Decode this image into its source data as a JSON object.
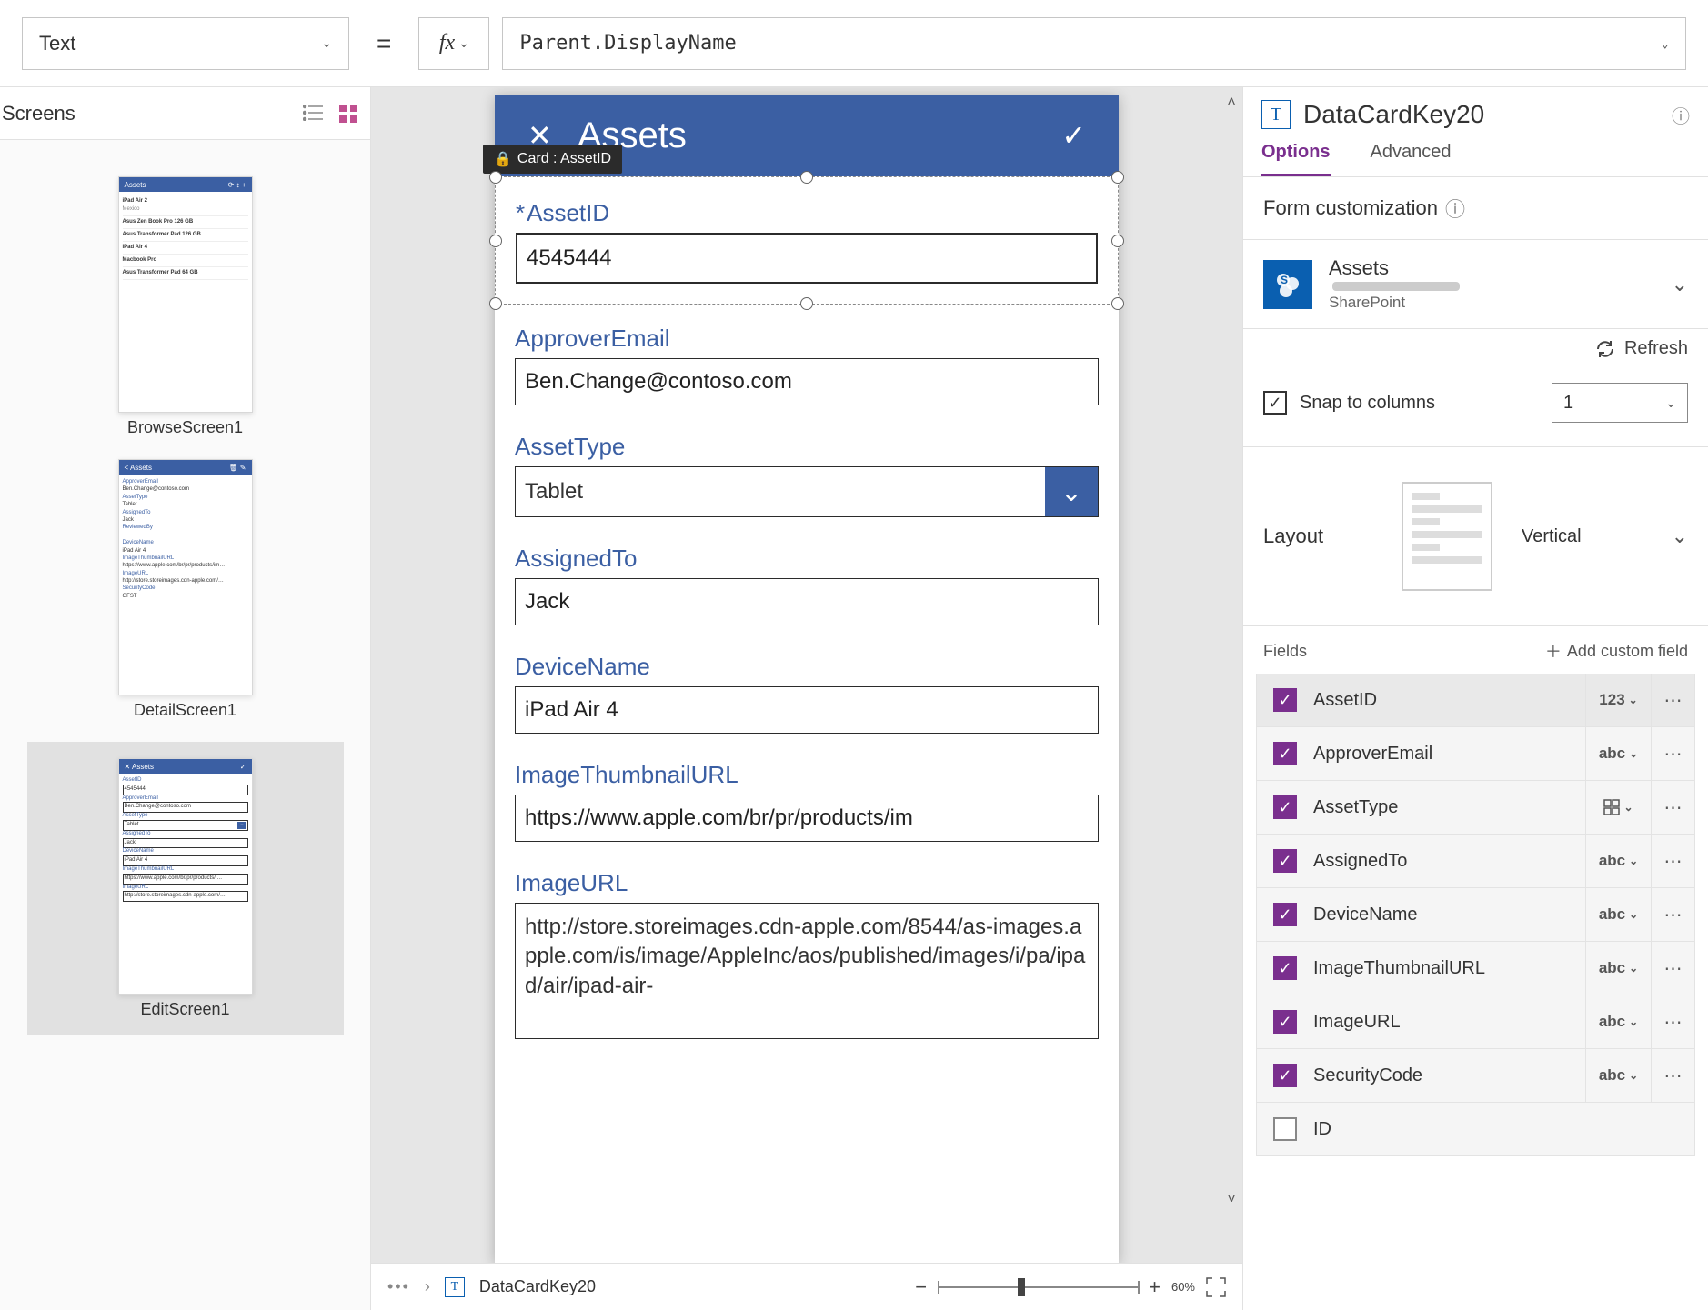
{
  "formulaBar": {
    "property": "Text",
    "formula": "Parent.DisplayName"
  },
  "leftPanel": {
    "title": "Screens",
    "screens": [
      {
        "name": "BrowseScreen1"
      },
      {
        "name": "DetailScreen1"
      },
      {
        "name": "EditScreen1"
      }
    ]
  },
  "canvas": {
    "appHeader": "Assets",
    "selectedCardTooltip": "Card : AssetID",
    "form": {
      "assetId": {
        "label": "AssetID",
        "value": "4545444",
        "required": true
      },
      "approverEmail": {
        "label": "ApproverEmail",
        "value": "Ben.Change@contoso.com"
      },
      "assetType": {
        "label": "AssetType",
        "value": "Tablet"
      },
      "assignedTo": {
        "label": "AssignedTo",
        "value": "Jack"
      },
      "deviceName": {
        "label": "DeviceName",
        "value": "iPad Air 4"
      },
      "imageThumbnailUrl": {
        "label": "ImageThumbnailURL",
        "value": "https://www.apple.com/br/pr/products/im"
      },
      "imageUrl": {
        "label": "ImageURL",
        "value": "http://store.storeimages.cdn-apple.com/8544/as-images.apple.com/is/image/AppleInc/aos/published/images/i/pa/ipad/air/ipad-air-"
      }
    }
  },
  "statusBar": {
    "breadcrumb": "DataCardKey20",
    "zoom": "60%"
  },
  "rightPanel": {
    "elementName": "DataCardKey20",
    "tabs": {
      "options": "Options",
      "advanced": "Advanced"
    },
    "formCustomization": "Form customization",
    "dataSource": {
      "name": "Assets",
      "provider": "SharePoint"
    },
    "refresh": "Refresh",
    "snapToColumns": {
      "label": "Snap to columns",
      "columns": "1"
    },
    "layout": {
      "label": "Layout",
      "value": "Vertical"
    },
    "fieldsHeader": "Fields",
    "addField": "Add custom field",
    "fields": [
      {
        "name": "AssetID",
        "type": "123",
        "checked": true,
        "selected": true
      },
      {
        "name": "ApproverEmail",
        "type": "abc",
        "checked": true
      },
      {
        "name": "AssetType",
        "type": "grid",
        "checked": true
      },
      {
        "name": "AssignedTo",
        "type": "abc",
        "checked": true
      },
      {
        "name": "DeviceName",
        "type": "abc",
        "checked": true
      },
      {
        "name": "ImageThumbnailURL",
        "type": "abc",
        "checked": true
      },
      {
        "name": "ImageURL",
        "type": "abc",
        "checked": true
      },
      {
        "name": "SecurityCode",
        "type": "abc",
        "checked": true
      },
      {
        "name": "ID",
        "type": "",
        "checked": false
      }
    ]
  }
}
